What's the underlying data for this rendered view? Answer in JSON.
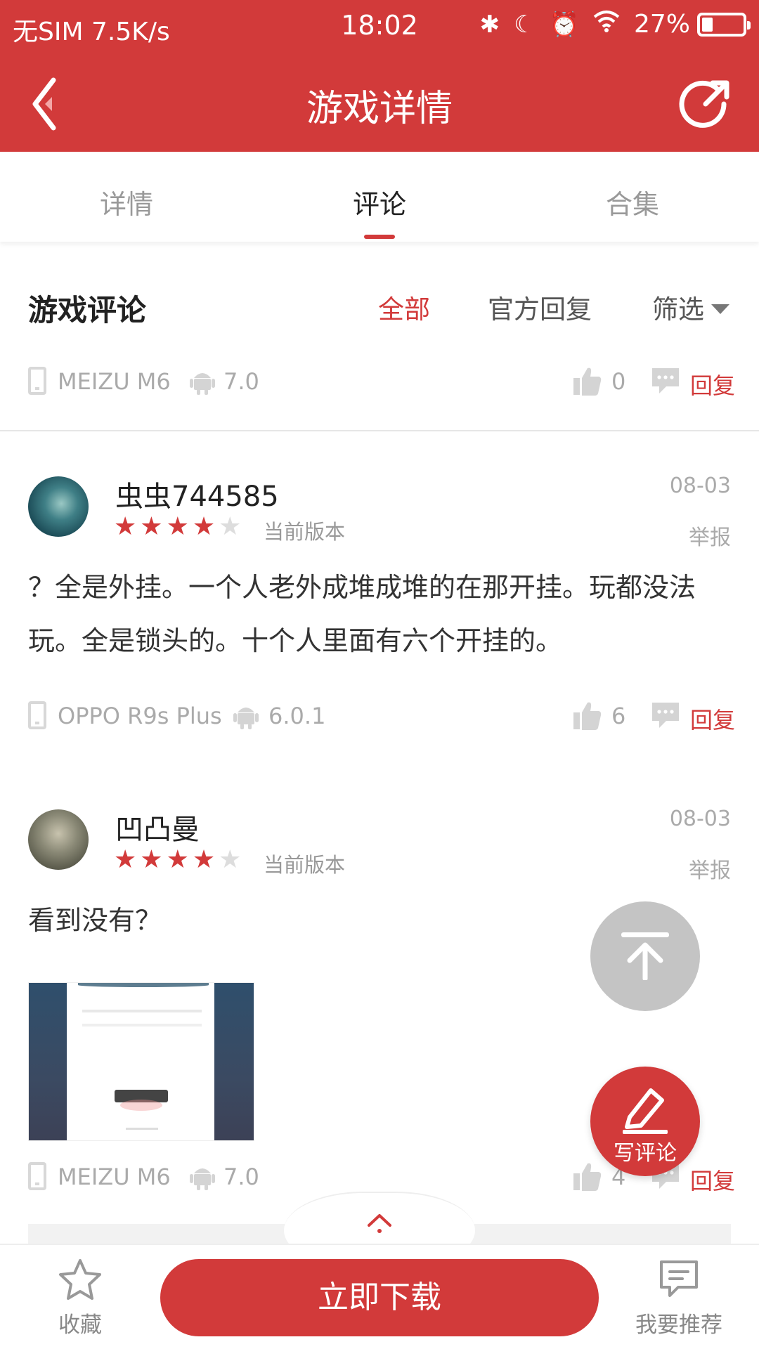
{
  "status_bar": {
    "carrier": "无SIM 7.5K/s",
    "time": "18:02",
    "battery": "27%",
    "battery_level": 0.27
  },
  "header": {
    "title": "游戏详情"
  },
  "tabs": [
    {
      "label": "详情"
    },
    {
      "label": "评论",
      "active": true
    },
    {
      "label": "合集"
    }
  ],
  "reviews_section": {
    "title": "游戏评论",
    "filters": {
      "all": "全部",
      "official": "官方回复",
      "filter": "筛选"
    }
  },
  "top_meta": {
    "device": "MEIZU M6",
    "os": "7.0",
    "likes": "0",
    "reply": "回复"
  },
  "comments": [
    {
      "username": "虫虫744585",
      "date": "08-03",
      "report": "举报",
      "rating": 4,
      "version": "当前版本",
      "text": "？全是外挂。一个人老外成堆成堆的在那开挂。玩都没法玩。全是锁头的。十个人里面有六个开挂的。",
      "device": "OPPO R9s Plus",
      "os": "6.0.1",
      "likes": "6",
      "reply": "回复"
    },
    {
      "username": "凹凸曼",
      "date": "08-03",
      "report": "举报",
      "rating": 4,
      "version": "当前版本",
      "text": "看到没有？",
      "device": "MEIZU M6",
      "os": "7.0",
      "likes": "4",
      "reply": "回复"
    }
  ],
  "fab": {
    "write_label": "写评论"
  },
  "bottom_bar": {
    "favorite": "收藏",
    "download": "立即下载",
    "recommend": "我要推荐"
  },
  "colors": {
    "accent": "#d23a3a",
    "muted": "#aaaaaa"
  }
}
